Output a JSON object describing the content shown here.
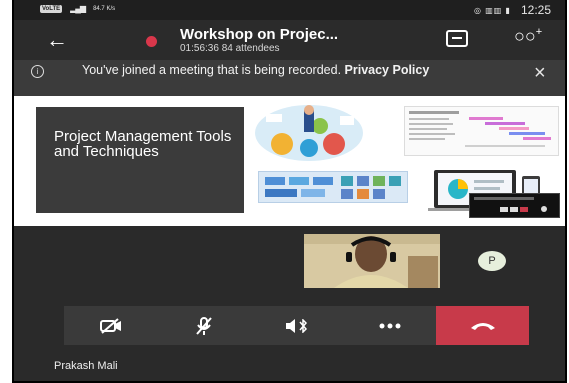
{
  "status_bar": {
    "network_badge": "VoLTE",
    "speed": "84.7 K/s",
    "system_icons": "◎ ▥▥ ▮",
    "clock": "12:25"
  },
  "header": {
    "meeting_title": "Workshop on Projec...",
    "meeting_info": "01:56:36  84 attendees",
    "recording_color": "#d9374b"
  },
  "banner": {
    "message": "You've joined a meeting that is being recorded.",
    "link": "Privacy Policy"
  },
  "slide": {
    "title": "Project Management Tools and Techniques",
    "title_box_color": "#3b3b3b"
  },
  "participants": {
    "avatar_initial": "P",
    "speaker_name": "Prakash Mali"
  },
  "controls": {
    "leave_color": "#c83a4a",
    "icons": [
      "camera-off-icon",
      "mic-off-icon",
      "speaker-bluetooth-icon",
      "more-options-icon",
      "hang-up-icon"
    ]
  }
}
